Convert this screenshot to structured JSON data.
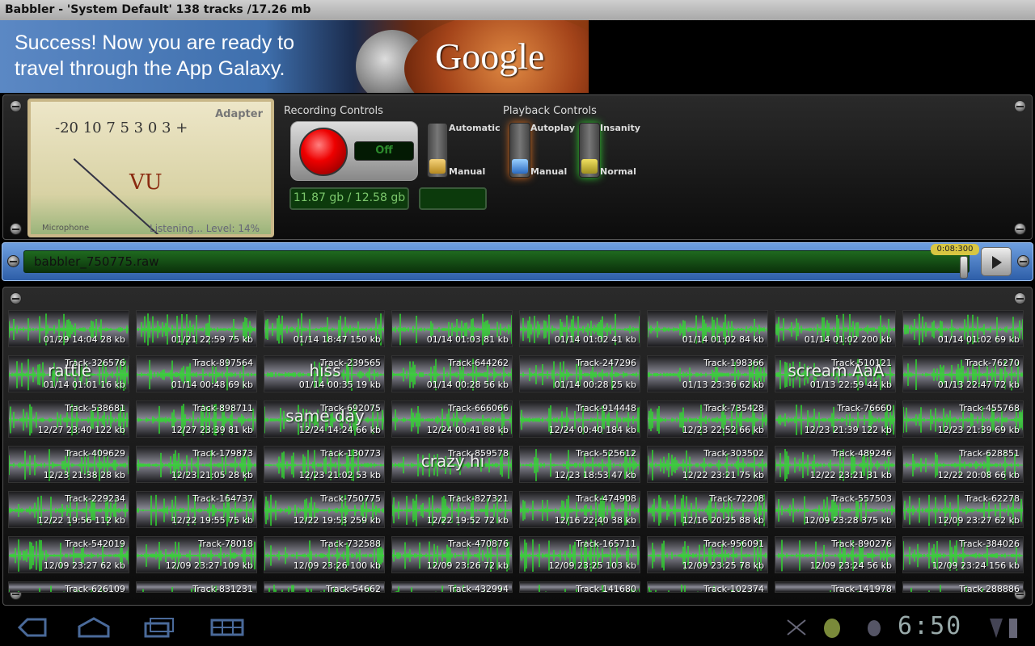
{
  "window": {
    "title": "Babbler - 'System Default' 138 tracks /17.26 mb"
  },
  "ad": {
    "message_line1": "Success! Now you are ready to",
    "message_line2": "travel through the App Galaxy.",
    "logo": "Google"
  },
  "meter": {
    "scale": "-20 10 7 5 3 0 3 +",
    "vu": "VU",
    "brand": "Adapter",
    "source": "Microphone",
    "status": "Listening...  Level: 14%"
  },
  "recording": {
    "label": "Recording Controls",
    "state": "Off",
    "storage": "11.87 gb / 12.58 gb",
    "toggle_top": "Automatic",
    "toggle_bottom": "Manual"
  },
  "playback": {
    "label": "Playback Controls",
    "toggle1_top": "Autoplay",
    "toggle1_bottom": "Manual",
    "toggle2_top": "Insanity",
    "toggle2_bottom": "Normal"
  },
  "player": {
    "filename": "babbler_750775.raw",
    "time": "0:08:300"
  },
  "tracks": [
    {
      "name": "",
      "meta": "01/29 14:04   28 kb",
      "label": ""
    },
    {
      "name": "",
      "meta": "01/21 22:59   75 kb",
      "label": ""
    },
    {
      "name": "",
      "meta": "01/14 18:47  150 kb",
      "label": ""
    },
    {
      "name": "",
      "meta": "01/14 01:03   81 kb",
      "label": ""
    },
    {
      "name": "",
      "meta": "01/14 01:02   41 kb",
      "label": ""
    },
    {
      "name": "",
      "meta": "01/14 01:02   84 kb",
      "label": ""
    },
    {
      "name": "",
      "meta": "01/14 01:02  200 kb",
      "label": ""
    },
    {
      "name": "",
      "meta": "01/14 01:02   69 kb",
      "label": ""
    },
    {
      "name": "Track-326576",
      "meta": "01/14 01:01   16 kb",
      "label": "rattle"
    },
    {
      "name": "Track-897564",
      "meta": "01/14 00:48   69 kb",
      "label": ""
    },
    {
      "name": "Track-239565",
      "meta": "01/14 00:35   19 kb",
      "label": "hiss"
    },
    {
      "name": "Track-644262",
      "meta": "01/14 00:28   56 kb",
      "label": ""
    },
    {
      "name": "Track-247296",
      "meta": "01/14 00:28   25 kb",
      "label": ""
    },
    {
      "name": "Track-198366",
      "meta": "01/13 23:36   62 kb",
      "label": ""
    },
    {
      "name": "Track-510121",
      "meta": "01/13 22:59   44 kb",
      "label": "scream AaA"
    },
    {
      "name": "Track-76270",
      "meta": "01/13 22:47   72 kb",
      "label": ""
    },
    {
      "name": "Track-538681",
      "meta": "12/27 23:40  122 kb",
      "label": ""
    },
    {
      "name": "Track-898711",
      "meta": "12/27 23:39  81 kb",
      "label": ""
    },
    {
      "name": "Track-692075",
      "meta": "12/24 14:24   66 kb",
      "label": "same day"
    },
    {
      "name": "Track-666066",
      "meta": "12/24 00:41   88 kb",
      "label": ""
    },
    {
      "name": "Track-914448",
      "meta": "12/24 00:40  184 kb",
      "label": ""
    },
    {
      "name": "Track-735428",
      "meta": "12/23 22:52   66 kb",
      "label": ""
    },
    {
      "name": "Track-76660",
      "meta": "12/23 21:39  122 kb",
      "label": ""
    },
    {
      "name": "Track-455768",
      "meta": "12/23 21:39   69 kb",
      "label": ""
    },
    {
      "name": "Track-409629",
      "meta": "12/23 21:38   28 kb",
      "label": ""
    },
    {
      "name": "Track-179873",
      "meta": "12/23 21:05   28 kb",
      "label": ""
    },
    {
      "name": "Track-130773",
      "meta": "12/23 21:02   53 kb",
      "label": ""
    },
    {
      "name": "Track-859578",
      "meta": "",
      "label": "crazy hi"
    },
    {
      "name": "Track-525612",
      "meta": "12/23 18:53   47 kb",
      "label": ""
    },
    {
      "name": "Track-303502",
      "meta": "12/22 23:21   75 kb",
      "label": ""
    },
    {
      "name": "Track-489246",
      "meta": "12/22 23:21   31 kb",
      "label": ""
    },
    {
      "name": "Track-628851",
      "meta": "12/22 20:08   66 kb",
      "label": ""
    },
    {
      "name": "Track-229234",
      "meta": "12/22 19:56  112 kb",
      "label": ""
    },
    {
      "name": "Track-164737",
      "meta": "12/22 19:55   75 kb",
      "label": ""
    },
    {
      "name": "Track-750775",
      "meta": "12/22 19:53  259 kb",
      "label": ""
    },
    {
      "name": "Track-827321",
      "meta": "12/22 19:52   72 kb",
      "label": ""
    },
    {
      "name": "Track-474908",
      "meta": "12/16 22:40   38 kb",
      "label": ""
    },
    {
      "name": "Track-72208",
      "meta": "12/16 20:25   88 kb",
      "label": ""
    },
    {
      "name": "Track-557503",
      "meta": "12/09 23:28  375 kb",
      "label": ""
    },
    {
      "name": "Track-62278",
      "meta": "12/09 23:27   62 kb",
      "label": ""
    },
    {
      "name": "Track-542019",
      "meta": "12/09 23:27   62 kb",
      "label": ""
    },
    {
      "name": "Track-78018",
      "meta": "12/09 23:27  109 kb",
      "label": ""
    },
    {
      "name": "Track-732588",
      "meta": "12/09 23:26  100 kb",
      "label": ""
    },
    {
      "name": "Track-470876",
      "meta": "12/09 23:26   72 kb",
      "label": ""
    },
    {
      "name": "Track-165711",
      "meta": "12/09 23:25  103 kb",
      "label": ""
    },
    {
      "name": "Track-956091",
      "meta": "12/09 23:25   78 kb",
      "label": ""
    },
    {
      "name": "Track-890276",
      "meta": "12/09 23:24   56 kb",
      "label": ""
    },
    {
      "name": "Track-384026",
      "meta": "12/09 23:24  156 kb",
      "label": ""
    },
    {
      "name": "Track-626109",
      "meta": "",
      "label": ""
    },
    {
      "name": "Track-831231",
      "meta": "",
      "label": ""
    },
    {
      "name": "Track-54662",
      "meta": "",
      "label": ""
    },
    {
      "name": "Track-432994",
      "meta": "",
      "label": ""
    },
    {
      "name": "Track-141680",
      "meta": "",
      "label": ""
    },
    {
      "name": "Track-102374",
      "meta": "",
      "label": ""
    },
    {
      "name": "Track-141978",
      "meta": "",
      "label": ""
    },
    {
      "name": "Track-288886",
      "meta": "",
      "label": ""
    }
  ],
  "statusbar": {
    "clock": "6:50"
  },
  "colors": {
    "wave": "#2fd82f",
    "wave_hot": "#e8a020",
    "lcd": "#7cc86c"
  },
  "icons": [
    "back-icon",
    "home-icon",
    "recent-apps-icon",
    "menu-icon",
    "fullscreen-icon",
    "android-icon",
    "usb-debug-icon",
    "battery-icon"
  ]
}
